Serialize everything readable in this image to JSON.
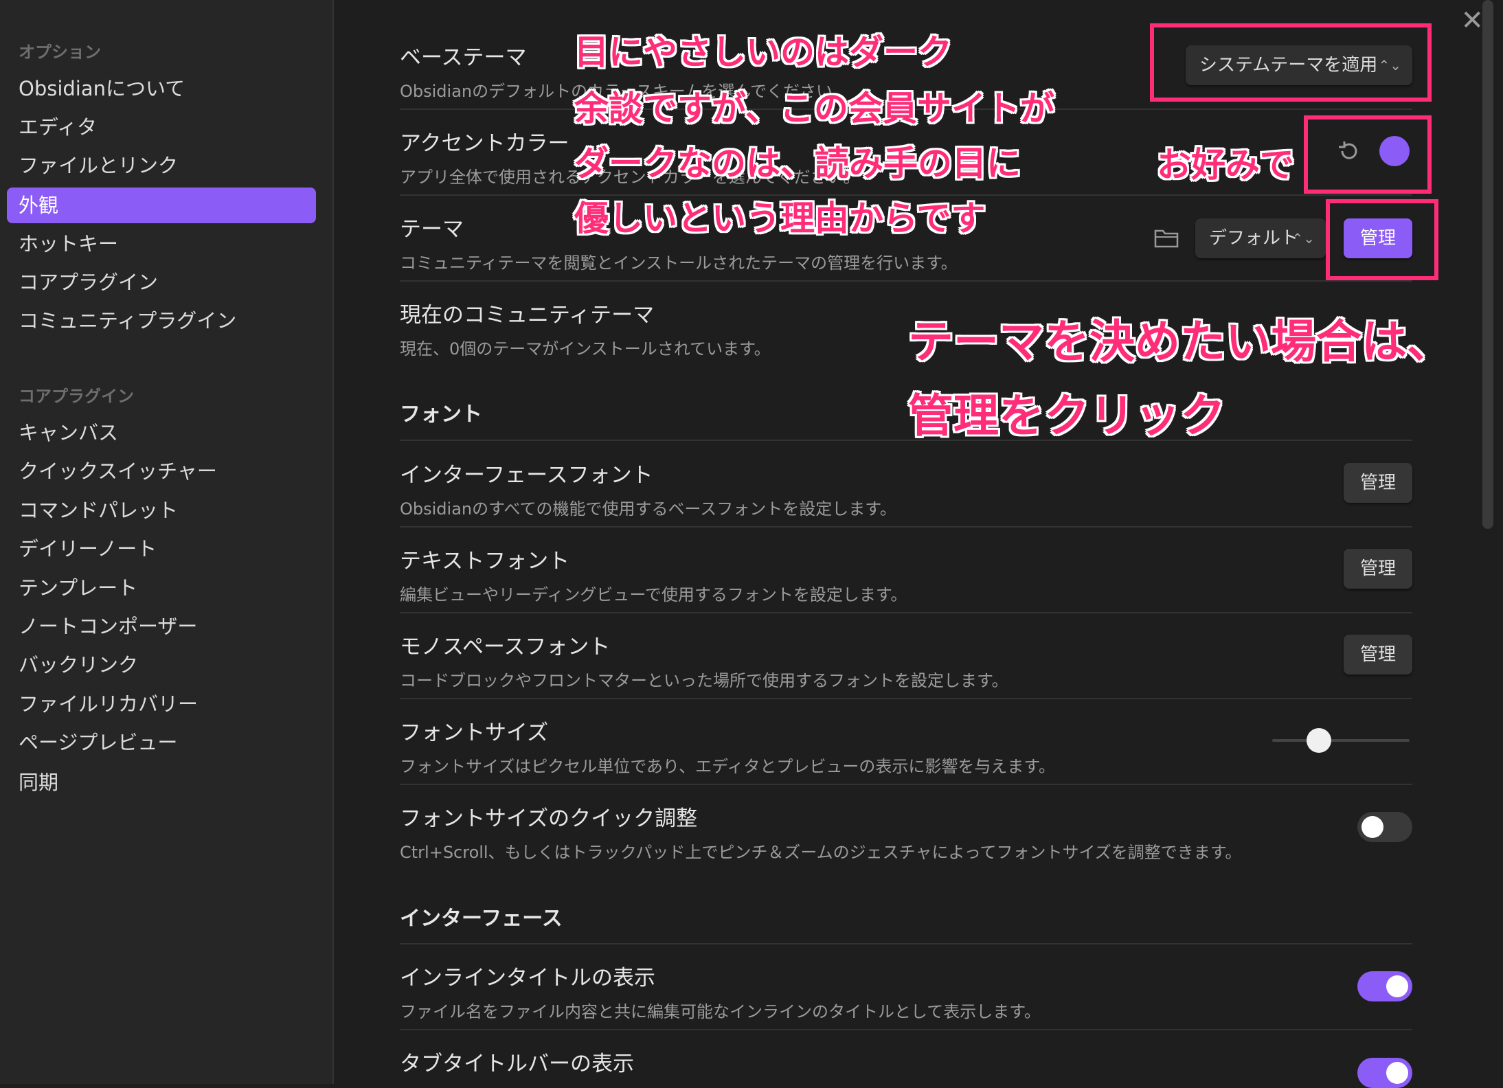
{
  "sidebar": {
    "options_heading": "オプション",
    "options": [
      "Obsidianについて",
      "エディタ",
      "ファイルとリンク",
      "外観",
      "ホットキー",
      "コアプラグイン",
      "コミュニティプラグイン"
    ],
    "core_heading": "コアプラグイン",
    "core": [
      "キャンバス",
      "クイックスイッチャー",
      "コマンドパレット",
      "デイリーノート",
      "テンプレート",
      "ノートコンポーザー",
      "バックリンク",
      "ファイルリカバリー",
      "ページプレビュー",
      "同期"
    ]
  },
  "settings": {
    "base_theme": {
      "name": "ベーステーマ",
      "desc": "Obsidianのデフォルトのカラースキームを選んでください。",
      "value": "システムテーマを適用"
    },
    "accent": {
      "name": "アクセントカラー",
      "desc": "アプリ全体で使用されるアクセントカラーを選んでください。",
      "color": "#8b5cf6"
    },
    "theme": {
      "name": "テーマ",
      "desc": "コミュニティテーマを閲覧とインストールされたテーマの管理を行います。",
      "value": "デフォルト",
      "button": "管理"
    },
    "community": {
      "name": "現在のコミュニティテーマ",
      "desc": "現在、0個のテーマがインストールされています。"
    },
    "font_section": "フォント",
    "interface_font": {
      "name": "インターフェースフォント",
      "desc": "Obsidianのすべての機能で使用するベースフォントを設定します。",
      "button": "管理"
    },
    "text_font": {
      "name": "テキストフォント",
      "desc": "編集ビューやリーディングビューで使用するフォントを設定します。",
      "button": "管理"
    },
    "mono_font": {
      "name": "モノスペースフォント",
      "desc": "コードブロックやフロントマターといった場所で使用するフォントを設定します。",
      "button": "管理"
    },
    "font_size": {
      "name": "フォントサイズ",
      "desc": "フォントサイズはピクセル単位であり、エディタとプレビューの表示に影響を与えます。",
      "level": 0.33
    },
    "quick_font": {
      "name": "フォントサイズのクイック調整",
      "desc": "Ctrl+Scroll、もしくはトラックパッド上でピンチ＆ズームのジェスチャによってフォントサイズを調整できます。",
      "on": false
    },
    "interface_section": "インターフェース",
    "inline_title": {
      "name": "インラインタイトルの表示",
      "desc": "ファイル名をファイル内容と共に編集可能なインラインのタイトルとして表示します。",
      "on": true
    },
    "tab_title": {
      "name": "タブタイトルバーの表示",
      "on": true
    }
  },
  "annotations": {
    "a1": "目にやさしいのはダーク",
    "a2": "余談ですが、この会員サイトが",
    "a3": "ダークなのは、読み手の目に",
    "a4": "優しいという理由からです",
    "a5": "お好みで",
    "a6": "テーマを決めたい場合は、",
    "a7": "管理をクリック"
  },
  "colors": {
    "accent": "#8b5cf6",
    "callout": "#ff2d78"
  }
}
